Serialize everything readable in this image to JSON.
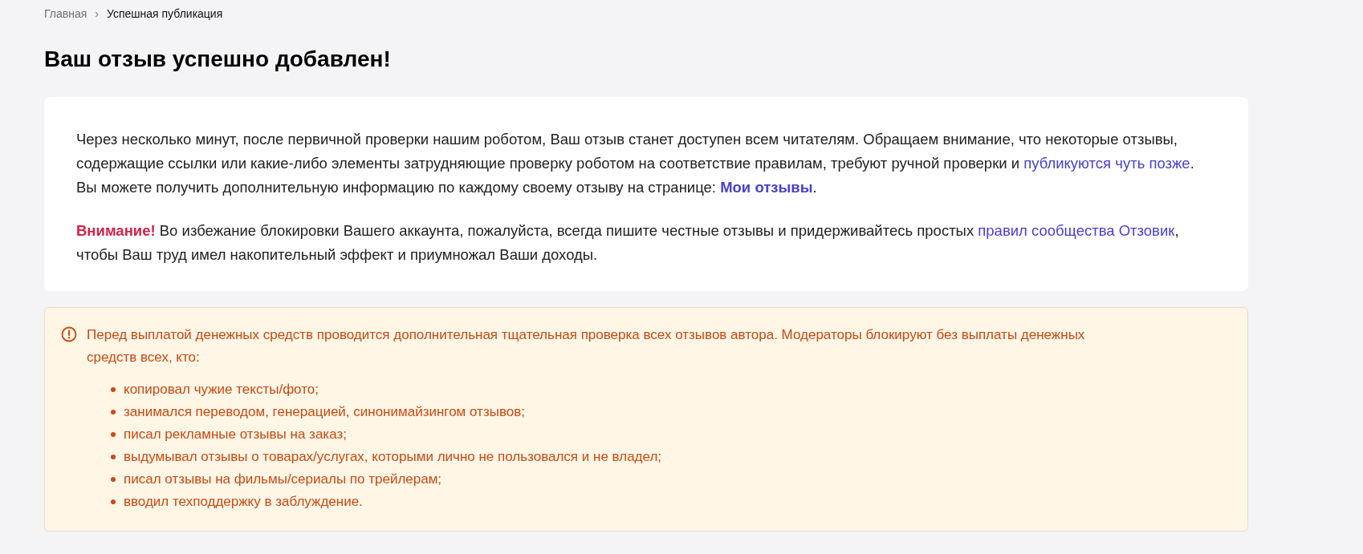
{
  "breadcrumbs": [
    {
      "label": "Главная",
      "current": false
    },
    {
      "label": "Успешная публикация",
      "current": true
    }
  ],
  "breadcrumb_separator": "›",
  "title": "Ваш отзыв успешно добавлен!",
  "info_card": {
    "paragraphs": [
      [
        {
          "kind": "text",
          "text": "Через несколько минут, после первичной проверки нашим роботом, Ваш отзыв станет доступен всем читателям. Обращаем внимание, что некоторые отзывы, содержащие ссылки или какие-либо элементы затрудняющие проверку роботом на соответствие правилам, требуют ручной проверки и"
        },
        {
          "kind": "link",
          "text": "публикуются чуть позже"
        },
        {
          "kind": "text",
          "text": ". Вы можете получить дополнительную информацию по каждому своему отзыву на странице:"
        },
        {
          "kind": "strong_link",
          "text": "Мои отзывы"
        },
        {
          "kind": "text",
          "text": "."
        }
      ],
      [
        {
          "kind": "alert",
          "text": "Внимание!"
        },
        {
          "kind": "text",
          "text": "Во избежание блокировки Вашего аккаунта, пожалуйста, всегда пишите честные отзывы и придерживайтесь простых"
        },
        {
          "kind": "link",
          "text": "правил сообщества Отзовик"
        },
        {
          "kind": "text",
          "text": ", чтобы Ваш труд имел накопительный эффект и приумножал Ваши доходы."
        }
      ]
    ]
  },
  "warning": {
    "text": "Перед выплатой денежных средств проводится дополнительная тщательная проверка всех отзывов автора. Модераторы блокируют без выплаты денежных средств всех, кто:",
    "items": [
      "копировал чужие тексты/фото;",
      "занимался переводом, генерацией, синонимайзингом отзывов;",
      "писал рекламные отзывы на заказ;",
      "выдумывал отзывы о товарах/услугах, которыми лично не пользовался и не владел;",
      "писал отзывы на фильмы/сериалы по трейлерам;",
      "вводил техподдержку в заблуждение."
    ]
  }
}
